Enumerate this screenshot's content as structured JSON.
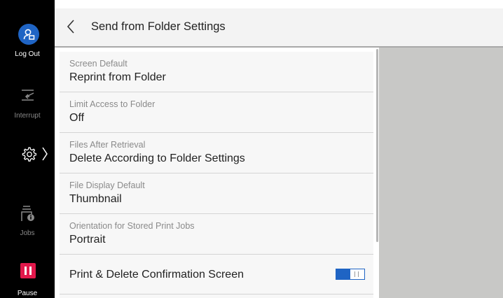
{
  "sidebar": {
    "logout_label": "Log Out",
    "interrupt_label": "Interrupt",
    "jobs_label": "Jobs",
    "pause_label": "Pause",
    "accent_color": "#1f64c4",
    "pause_color": "#e2184b"
  },
  "header": {
    "title": "Send from Folder Settings"
  },
  "settings": [
    {
      "caption": "Screen Default",
      "value": "Reprint from Folder"
    },
    {
      "caption": "Limit Access to Folder",
      "value": "Off"
    },
    {
      "caption": "Files After Retrieval",
      "value": "Delete According to Folder Settings"
    },
    {
      "caption": "File Display Default",
      "value": "Thumbnail"
    },
    {
      "caption": "Orientation for Stored Print Jobs",
      "value": "Portrait"
    }
  ],
  "toggle_setting": {
    "label": "Print & Delete Confirmation Screen",
    "enabled": true
  },
  "icons": {
    "logout": "person-logout-icon",
    "interrupt": "interrupt-icon",
    "settings": "gear-icon",
    "settings_arrow": "chevron-right-icon",
    "jobs": "jobs-icon",
    "pause": "pause-icon",
    "back": "chevron-left-icon"
  }
}
